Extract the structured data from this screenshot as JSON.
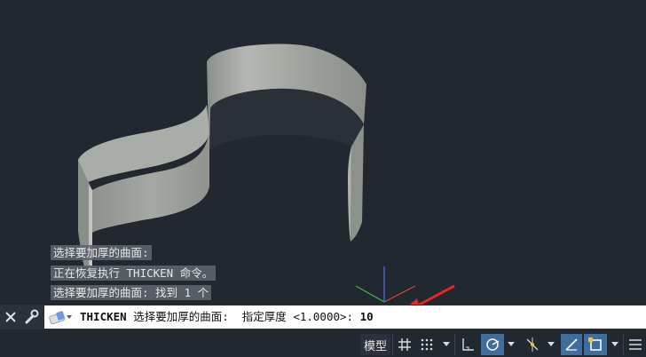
{
  "command_history": [
    "选择要加厚的曲面:",
    "正在恢复执行 THICKEN 命令。",
    "选择要加厚的曲面: 找到 1 个"
  ],
  "command_line": {
    "command": "THICKEN",
    "prompt": " 选择要加厚的曲面:  指定厚度 <1.0000>: ",
    "input_value": "10"
  },
  "statusbar": {
    "model_label": "模型"
  },
  "icons": {
    "close": "close-icon",
    "customize": "wrench-icon",
    "recent_commands": "eraser-icon",
    "annotation_arrow": "red-arrow"
  },
  "colors": {
    "viewport_bg": "#212830",
    "surface": "#9ea29c",
    "active_toggle": "#3f6d9c",
    "annotation": "#e8261e"
  }
}
